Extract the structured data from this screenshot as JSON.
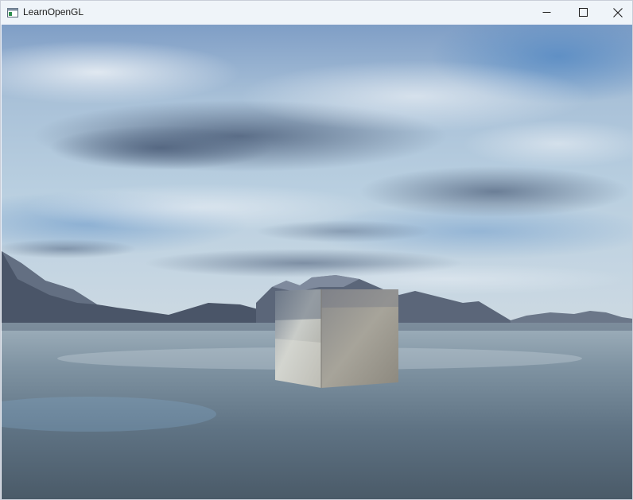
{
  "window": {
    "title": "LearnOpenGL",
    "controls": {
      "minimize": "minimize",
      "maximize": "maximize",
      "close": "close"
    }
  },
  "scene": {
    "description_icon": "app-window-icon",
    "colors": {
      "sky_top": "#6f93bd",
      "sky_mid": "#aac4da",
      "horizon": "#c9d8e2",
      "water_near": "#4e6274",
      "water_far": "#8a9eac",
      "mountain": "#4f5a6c",
      "cube_left": "#b8b8b4",
      "cube_right": "#9a978e"
    }
  }
}
